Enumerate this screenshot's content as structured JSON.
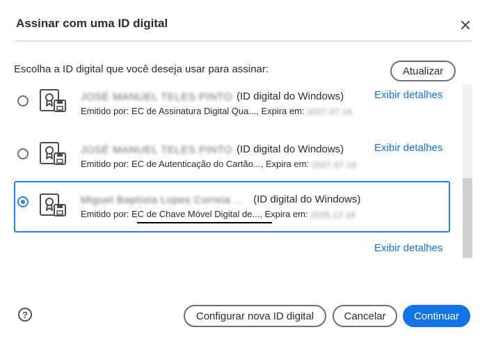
{
  "dialog": {
    "title": "Assinar com uma ID digital",
    "close_icon": "close-icon"
  },
  "prompt": "Escolha a ID digital que você deseja usar para assinar:",
  "refresh_label": "Atualizar",
  "ids": [
    {
      "name": "JOSÉ MANUEL TELES PINTO",
      "kind": "(ID digital do Windows)",
      "issuer_prefix": "Emitido por: ",
      "issuer": "EC de Assinatura Digital Qua...",
      "expires_label": ", Expira em: ",
      "expires": "2027.07.16",
      "details": "Exibir detalhes",
      "selected": false
    },
    {
      "name": "JOSÉ MANUEL TELES PINTO",
      "kind": "(ID digital do Windows)",
      "issuer_prefix": "Emitido por: ",
      "issuer": "EC de Autenticação do Cartão...",
      "expires_label": ", Expira em: ",
      "expires": "2027.07.16",
      "details": "Exibir detalhes",
      "selected": false
    },
    {
      "name": "Miguel Baptista Lopes Correia ...",
      "kind": "(ID digital do Windows)",
      "issuer_prefix": "Emitido por: ",
      "issuer": "EC de Chave Móvel Digital de...",
      "expires_label": ", Expira em: ",
      "expires": "2025.12.16",
      "details": "Exibir detalhes",
      "selected": true
    }
  ],
  "footer": {
    "help_label": "?",
    "configure_label": "Configurar nova ID digital",
    "cancel_label": "Cancelar",
    "continue_label": "Continuar"
  },
  "colors": {
    "accent": "#1473e6",
    "selected_border": "#2680eb",
    "annotation_underline": "#000000"
  }
}
